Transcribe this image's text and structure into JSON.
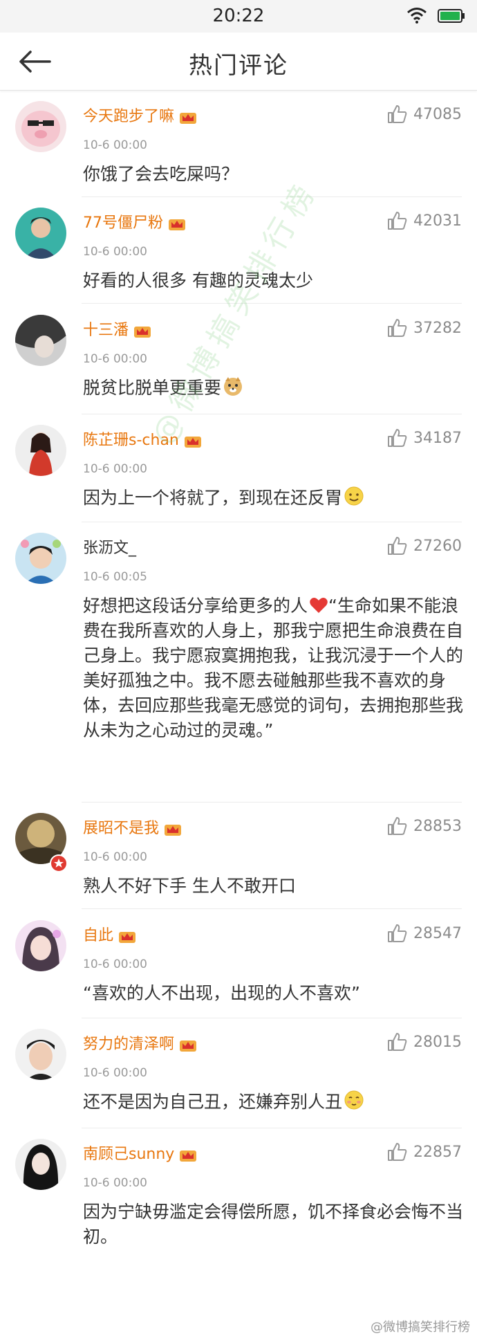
{
  "status_bar": {
    "time": "20:22",
    "wifi_icon": "wifi-icon",
    "battery_icon": "battery-icon",
    "battery_color": "#22b14c"
  },
  "header": {
    "title": "热门评论",
    "back_icon": "arrow-left-icon"
  },
  "colors": {
    "username": "#e8770f",
    "text": "#333333",
    "meta": "#9a9a9a"
  },
  "comments": [
    {
      "user": "今天跑步了嘛",
      "time": "10-6 00:00",
      "likes": "47085",
      "text": "你饿了会去吃屎吗？",
      "badge": "crown-icon"
    },
    {
      "user": "77号僵尸粉",
      "time": "10-6 00:00",
      "likes": "42031",
      "text": "好看的人很多 有趣的灵魂太少",
      "badge": "crown-icon"
    },
    {
      "user": "十三潘",
      "time": "10-6 00:00",
      "likes": "37282",
      "text": "脱贫比脱单更重要",
      "badge": "crown-icon",
      "emoji": "doge-emoji"
    },
    {
      "user": "陈芷珊s-chan",
      "time": "10-6 00:00",
      "likes": "34187",
      "text": "因为上一个将就了，到现在还反胃",
      "badge": "crown-icon",
      "emoji": "smile-emoji"
    },
    {
      "user": "张沥文_",
      "time": "10-6 00:05",
      "likes": "27260",
      "text_a": "好想把这段话分享给更多的人",
      "text_b": "“生命如果不能浪费在我所喜欢的人身上，那我宁愿把生命浪费在自己身上。我宁愿寂寞拥抱我，让我沉浸于一个人的美好孤独之中。我不愿去碰触那些我不喜欢的身体，去回应那些我毫无感觉的词句，去拥抱那些我从未为之心动过的灵魂。”",
      "emoji": "heart-emoji"
    },
    {
      "user": "展昭不是我",
      "time": "10-6 00:00",
      "likes": "28853",
      "text": "熟人不好下手 生人不敢开口",
      "badge": "crown-icon"
    },
    {
      "user": "自此",
      "time": "10-6 00:00",
      "likes": "28547",
      "text": "“喜欢的人不出现，出现的人不喜欢”",
      "badge": "crown-icon"
    },
    {
      "user": "努力的清泽啊",
      "time": "10-6 00:00",
      "likes": "28015",
      "text": "还不是因为自己丑，还嫌弃别人丑",
      "badge": "crown-icon",
      "emoji": "shy-emoji"
    },
    {
      "user": "南顾己sunny",
      "time": "10-6 00:00",
      "likes": "22857",
      "text": "因为宁缺毋滥定会得偿所愿，饥不择食必会悔不当初。",
      "badge": "crown-icon"
    }
  ],
  "watermark": "@微博搞笑排行榜",
  "footer_watermark": "@微博搞笑排行榜"
}
